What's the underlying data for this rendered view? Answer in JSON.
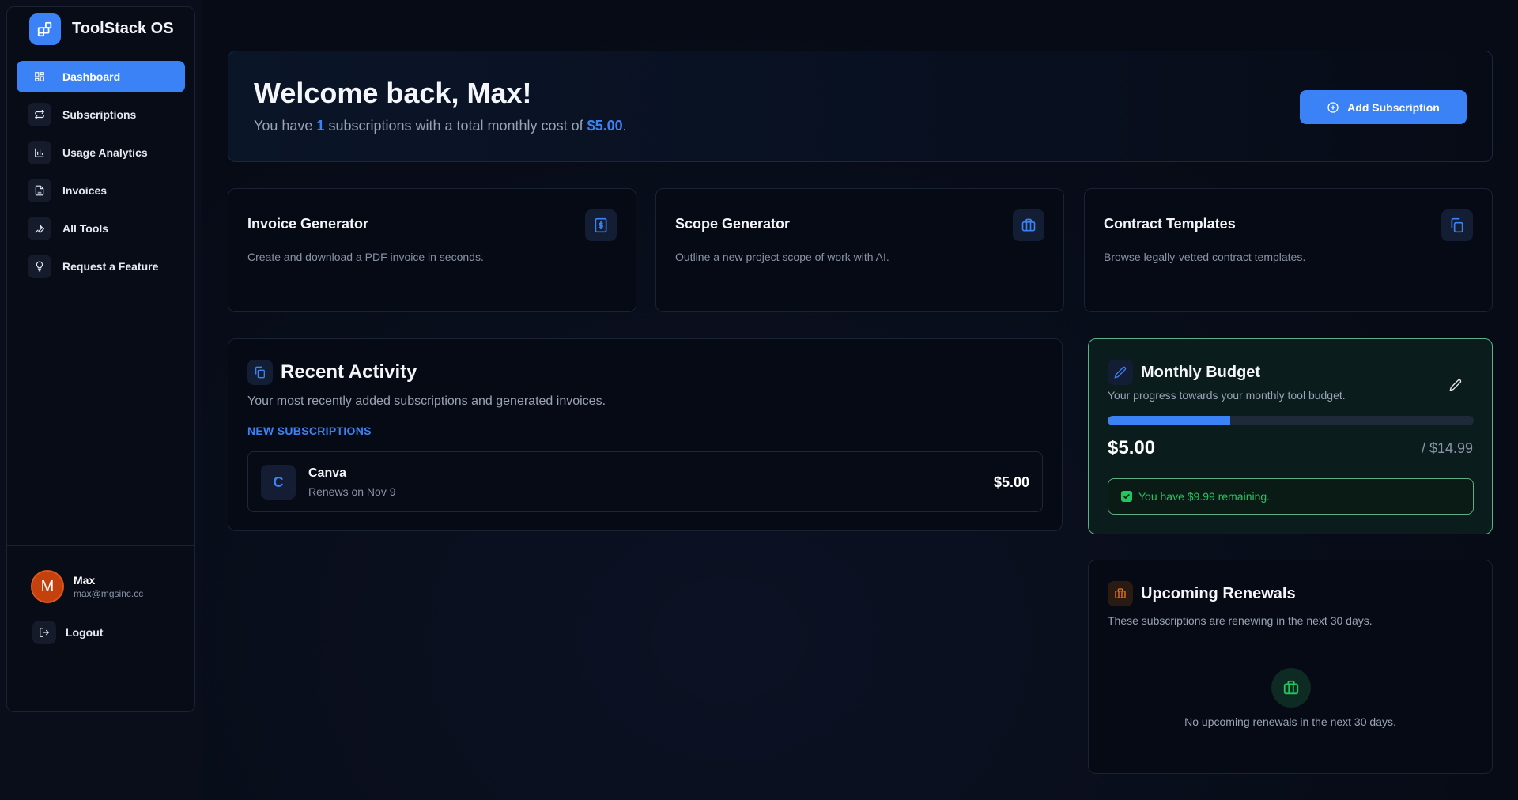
{
  "app": {
    "name": "ToolStack OS"
  },
  "sidebar": {
    "items": [
      {
        "label": "Dashboard",
        "icon": "grid-icon",
        "active": true
      },
      {
        "label": "Subscriptions",
        "icon": "repeat-icon"
      },
      {
        "label": "Usage Analytics",
        "icon": "bar-chart-icon"
      },
      {
        "label": "Invoices",
        "icon": "file-text-icon"
      },
      {
        "label": "All Tools",
        "icon": "wrench-icon"
      },
      {
        "label": "Request a Feature",
        "icon": "lightbulb-icon"
      }
    ],
    "user": {
      "initial": "M",
      "name": "Max",
      "email": "max@mgsinc.cc"
    },
    "logout_label": "Logout"
  },
  "welcome": {
    "title": "Welcome back, Max!",
    "text_prefix": "You have ",
    "count": "1",
    "text_mid": " subscriptions with a total monthly cost of ",
    "total": "$5.00",
    "text_suffix": ".",
    "add_button": "Add Subscription"
  },
  "tools": [
    {
      "title": "Invoice Generator",
      "desc": "Create and download a PDF invoice in seconds.",
      "icon": "invoice-dollar-icon"
    },
    {
      "title": "Scope Generator",
      "desc": "Outline a new project scope of work with AI.",
      "icon": "briefcase-icon"
    },
    {
      "title": "Contract Templates",
      "desc": "Browse legally-vetted contract templates.",
      "icon": "copy-icon"
    }
  ],
  "activity": {
    "title": "Recent Activity",
    "desc": "Your most recently added subscriptions and generated invoices.",
    "section_label": "NEW SUBSCRIPTIONS",
    "items": [
      {
        "initial": "C",
        "name": "Canva",
        "renew": "Renews on Nov 9",
        "price": "$5.00"
      }
    ]
  },
  "budget": {
    "title": "Monthly Budget",
    "desc": "Your progress towards your monthly tool budget.",
    "spent": "$5.00",
    "limit": "/ $14.99",
    "progress": 0.334,
    "remaining": "You have $9.99 remaining."
  },
  "renewals": {
    "title": "Upcoming Renewals",
    "desc": "These subscriptions are renewing in the next 30 days.",
    "empty": "No upcoming renewals in the next 30 days."
  },
  "colors": {
    "accent": "#3b82f6",
    "success": "#22c55e",
    "warning": "#f97316",
    "avatar": "#c2410c"
  }
}
